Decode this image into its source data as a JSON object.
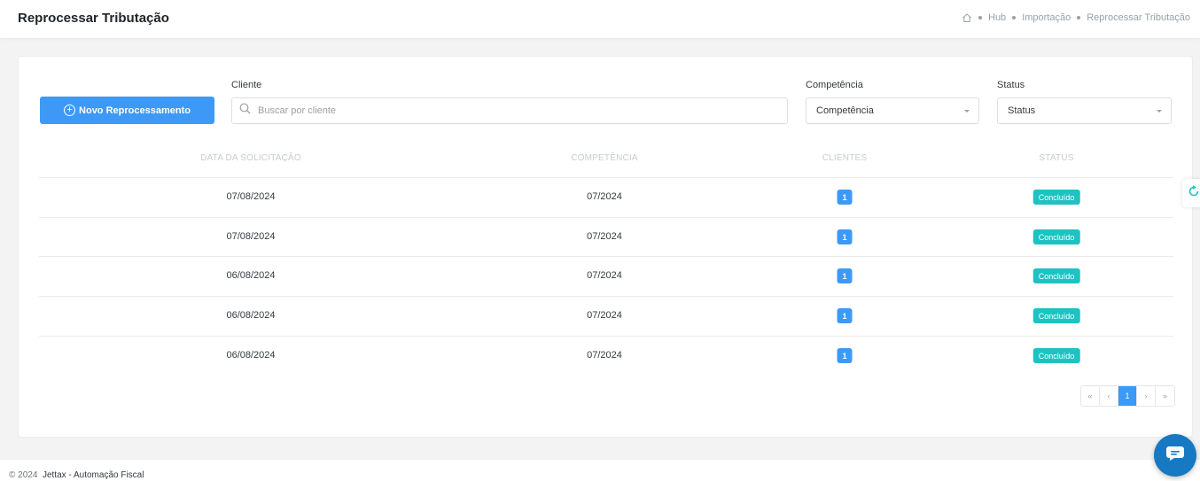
{
  "header": {
    "title": "Reprocessar Tributação",
    "breadcrumb": [
      "Hub",
      "Importação",
      "Reprocessar Tributação"
    ]
  },
  "toolbar": {
    "new_button_label": "Novo Reprocessamento",
    "client_label": "Cliente",
    "client_placeholder": "Buscar por cliente",
    "competencia_label": "Competência",
    "competencia_value": "Competência",
    "status_label": "Status",
    "status_value": "Status"
  },
  "table": {
    "headers": [
      "Data da Solicitação",
      "Competência",
      "Clientes",
      "Status"
    ],
    "rows": [
      {
        "date": "07/08/2024",
        "competencia": "07/2024",
        "clientes": "1",
        "status": "Concluído"
      },
      {
        "date": "07/08/2024",
        "competencia": "07/2024",
        "clientes": "1",
        "status": "Concluído"
      },
      {
        "date": "06/08/2024",
        "competencia": "07/2024",
        "clientes": "1",
        "status": "Concluído"
      },
      {
        "date": "06/08/2024",
        "competencia": "07/2024",
        "clientes": "1",
        "status": "Concluído"
      },
      {
        "date": "06/08/2024",
        "competencia": "07/2024",
        "clientes": "1",
        "status": "Concluído"
      }
    ]
  },
  "pagination": {
    "first": "«",
    "prev": "‹",
    "current": "1",
    "next": "›",
    "last": "»"
  },
  "footer": {
    "copyright": "© 2024",
    "brand": "Jettax - Automação Fiscal"
  },
  "colors": {
    "primary": "#3d99f5",
    "success": "#1ec2c2",
    "chat": "#1779c1"
  }
}
